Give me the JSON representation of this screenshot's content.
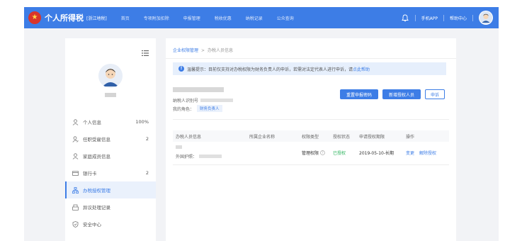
{
  "header": {
    "brand": "个人所得税",
    "region": "[浙江地税]",
    "nav": [
      "首页",
      "专项附加扣除",
      "申报管理",
      "税收优惠",
      "纳税记录",
      "公众查询"
    ],
    "app_link": "手机APP",
    "help_link": "帮助中心",
    "accent_color": "#3d7de6",
    "bell_icon": "bell-icon"
  },
  "sidebar": {
    "items": [
      {
        "label": "个人信息",
        "count": "100%",
        "icon": "person-icon"
      },
      {
        "label": "任职受雇信息",
        "count": "2",
        "icon": "person-work-icon"
      },
      {
        "label": "家庭成员信息",
        "count": "",
        "icon": "family-icon"
      },
      {
        "label": "银行卡",
        "count": "2",
        "icon": "card-icon"
      },
      {
        "label": "办税授权管理",
        "count": "",
        "icon": "org-icon",
        "active": true
      },
      {
        "label": "异议处理记录",
        "count": "",
        "icon": "dispute-icon"
      },
      {
        "label": "安全中心",
        "count": "",
        "icon": "shield-icon"
      }
    ]
  },
  "breadcrumb": {
    "parent": "企业权限管理",
    "separator": ">",
    "current": "办税人员信息"
  },
  "notice": {
    "prefix": "温馨提示：目前仅支持对办税权限为财务负责人的申诉，若需对法定代表人进行申诉，请",
    "link": "点此帮助"
  },
  "company": {
    "taxpayer_id_label": "纳税人识别号",
    "role_label": "我的角色：",
    "role_tag": "财务负责人"
  },
  "actions": {
    "reset_code": "重置申报密码",
    "add_auth": "新增授权人员",
    "appeal": "申诉"
  },
  "table": {
    "headers": [
      "办税人员信息",
      "所属企业名称",
      "权限类型",
      "授权状态",
      "申请授权期限",
      "操作"
    ],
    "rows": [
      {
        "id_label": "外国护照：",
        "permission": "管理权限",
        "status": "已授权",
        "period": "2019-05-10-长期",
        "action_change": "变更",
        "action_revoke": "解除授权"
      }
    ]
  }
}
